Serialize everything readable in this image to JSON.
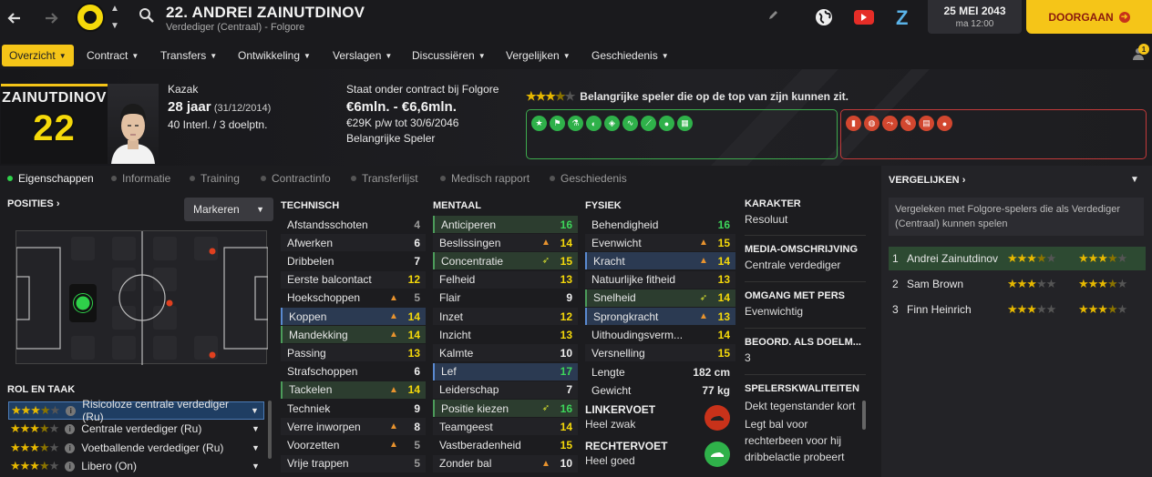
{
  "topbar": {
    "player_title": "22. ANDREI ZAINUTDINOV",
    "player_sub": "Verdediger (Centraal) - Folgore",
    "date": "25 MEI 2043",
    "time": "ma 12:00",
    "continue_label": "DOORGAAN"
  },
  "menu": [
    {
      "label": "Overzicht",
      "active": true
    },
    {
      "label": "Contract"
    },
    {
      "label": "Transfers"
    },
    {
      "label": "Ontwikkeling"
    },
    {
      "label": "Verslagen"
    },
    {
      "label": "Discussiëren"
    },
    {
      "label": "Vergelijken"
    },
    {
      "label": "Geschiedenis"
    }
  ],
  "notifications": "1",
  "header": {
    "card_name": "ZAINUTDINOV",
    "card_number": "22",
    "nationality": "Kazak",
    "age": "28 jaar",
    "dob": "(31/12/2014)",
    "caps": "40 Interl. / 3 doelptn.",
    "contract_status": "Staat onder contract bij Folgore",
    "value": "€6mln. - €6,6mln.",
    "wage": "€29K p/w tot 30/6/2046",
    "squad_status": "Belangrijke Speler",
    "rating_stars": 3.5,
    "rating_text": "Belangrijke speler die op de top van zijn kunnen zit."
  },
  "subtabs": [
    "Eigenschappen",
    "Informatie",
    "Training",
    "Contractinfo",
    "Transferlijst",
    "Medisch rapport",
    "Geschiedenis"
  ],
  "positions": {
    "title": "POSITIES",
    "mark_label": "Markeren"
  },
  "roles": {
    "title": "ROL EN TAAK",
    "items": [
      {
        "label": "Risicoloze centrale verdediger (Ru)",
        "stars": 3.5,
        "selected": true
      },
      {
        "label": "Centrale verdediger (Ru)",
        "stars": 3.5
      },
      {
        "label": "Voetballende verdediger (Ru)",
        "stars": 3.5
      },
      {
        "label": "Libero (On)",
        "stars": 3.5
      }
    ]
  },
  "technisch": {
    "title": "TECHNISCH",
    "rows": [
      {
        "name": "Afstandsschoten",
        "value": "4"
      },
      {
        "name": "Afwerken",
        "value": "6"
      },
      {
        "name": "Dribbelen",
        "value": "7"
      },
      {
        "name": "Eerste balcontact",
        "value": "12"
      },
      {
        "name": "Hoekschoppen",
        "value": "5",
        "up": true
      },
      {
        "name": "Koppen",
        "value": "14",
        "up": true,
        "hl": "blue"
      },
      {
        "name": "Mandekking",
        "value": "14",
        "up": true,
        "hl": "green"
      },
      {
        "name": "Passing",
        "value": "13"
      },
      {
        "name": "Strafschoppen",
        "value": "6"
      },
      {
        "name": "Tackelen",
        "value": "14",
        "up": true,
        "hl": "green"
      },
      {
        "name": "Techniek",
        "value": "9"
      },
      {
        "name": "Verre inworpen",
        "value": "8",
        "up": true
      },
      {
        "name": "Voorzetten",
        "value": "5",
        "up": true
      },
      {
        "name": "Vrije trappen",
        "value": "5"
      }
    ]
  },
  "mentaal": {
    "title": "MENTAAL",
    "rows": [
      {
        "name": "Anticiperen",
        "value": "16",
        "hl": "green"
      },
      {
        "name": "Beslissingen",
        "value": "14",
        "up": true
      },
      {
        "name": "Concentratie",
        "value": "15",
        "hl": "green",
        "tick": true
      },
      {
        "name": "Felheid",
        "value": "13"
      },
      {
        "name": "Flair",
        "value": "9"
      },
      {
        "name": "Inzet",
        "value": "12"
      },
      {
        "name": "Inzicht",
        "value": "13"
      },
      {
        "name": "Kalmte",
        "value": "10"
      },
      {
        "name": "Lef",
        "value": "17",
        "hl": "blue"
      },
      {
        "name": "Leiderschap",
        "value": "7"
      },
      {
        "name": "Positie kiezen",
        "value": "16",
        "hl": "green",
        "tick": true
      },
      {
        "name": "Teamgeest",
        "value": "14"
      },
      {
        "name": "Vastberadenheid",
        "value": "15"
      },
      {
        "name": "Zonder bal",
        "value": "10",
        "up": true
      }
    ]
  },
  "fysiek": {
    "title": "FYSIEK",
    "rows": [
      {
        "name": "Behendigheid",
        "value": "16"
      },
      {
        "name": "Evenwicht",
        "value": "15",
        "up": true
      },
      {
        "name": "Kracht",
        "value": "14",
        "up": true,
        "hl": "blue"
      },
      {
        "name": "Natuurlijke fitheid",
        "value": "13"
      },
      {
        "name": "Snelheid",
        "value": "14",
        "hl": "green",
        "tick": true
      },
      {
        "name": "Sprongkracht",
        "value": "13",
        "up": true,
        "hl": "blue"
      },
      {
        "name": "Uithoudingsverm...",
        "value": "14"
      },
      {
        "name": "Versnelling",
        "value": "15"
      }
    ],
    "lengte_label": "Lengte",
    "lengte": "182 cm",
    "gewicht_label": "Gewicht",
    "gewicht": "77 kg",
    "left_foot_title": "LINKERVOET",
    "left_foot": "Heel zwak",
    "right_foot_title": "RECHTERVOET",
    "right_foot": "Heel goed"
  },
  "karakter": {
    "title": "KARAKTER",
    "value": "Resoluut",
    "media_title": "MEDIA-OMSCHRIJVING",
    "media": "Centrale verdediger",
    "press_title": "OMGANG MET PERS",
    "press": "Evenwichtig",
    "gk_title": "BEOORD. ALS DOELM...",
    "gk": "3",
    "qualities_title": "SPELERSKWALITEITEN",
    "qualities": [
      "Dekt tegenstander kort",
      "Legt bal voor rechterbeen voor hij dribbelactie probeert"
    ]
  },
  "compare": {
    "title": "VERGELIJKEN",
    "desc": "Vergeleken met Folgore-spelers die als Verdediger (Centraal) kunnen spelen",
    "rows": [
      {
        "rank": "1",
        "name": "Andrei Zainutdinov",
        "cur": 3.5,
        "pot": 3.5
      },
      {
        "rank": "2",
        "name": "Sam Brown",
        "cur": 3,
        "pot": 3.5
      },
      {
        "rank": "3",
        "name": "Finn Heinrich",
        "cur": 3,
        "pot": 3.5
      }
    ]
  }
}
